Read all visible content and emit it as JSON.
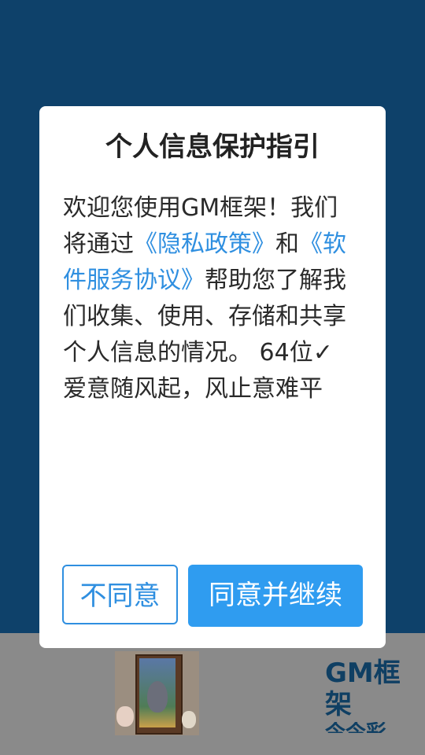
{
  "background_app": {
    "title": "GM框架",
    "subtitle": "今今彩"
  },
  "dialog": {
    "title": "个人信息保护指引",
    "body_prefix": "欢迎您使用GM框架！我们将通过",
    "privacy_link": "《隐私政策》",
    "and": "和",
    "service_link": "《软件服务协议》",
    "body_suffix": "帮助您了解我们收集、使用、存储和共享个人信息的情况。 64位✓ 爱意随风起，风止意难平",
    "disagree_label": "不同意",
    "agree_label": "同意并继续"
  },
  "colors": {
    "accent": "#2f9cf0",
    "link": "#2f8fe0",
    "overlay_bg": "#0e416a"
  }
}
